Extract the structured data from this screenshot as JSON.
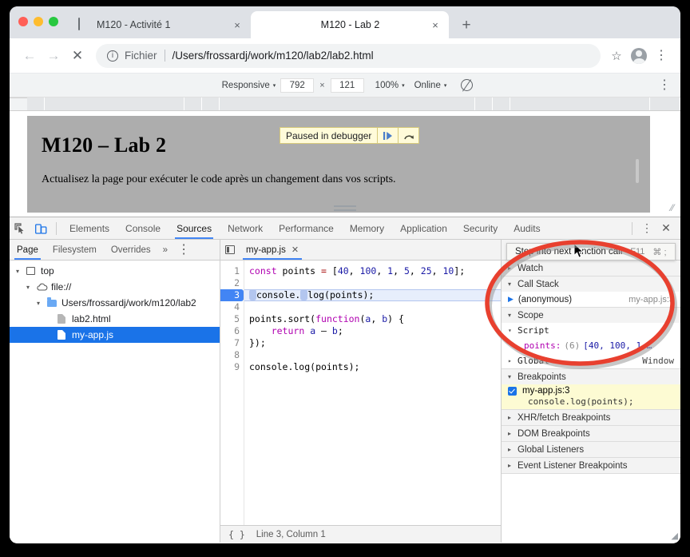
{
  "browser": {
    "tabs": [
      {
        "title": "M120 - Activité 1",
        "active": false,
        "favicon": "document-icon",
        "close_label": "×"
      },
      {
        "title": "M120 - Lab 2",
        "active": true,
        "favicon": "loading-dot-icon",
        "close_label": "×"
      }
    ],
    "new_tab_label": "+",
    "nav": {
      "back": "←",
      "forward": "→",
      "stop": "✕"
    },
    "omnibox": {
      "scheme_label": "Fichier",
      "url": "/Users/frossardj/work/m120/lab2/lab2.html",
      "info_glyph": "i",
      "bookmark_glyph": "☆",
      "menu_glyph": "⋮"
    }
  },
  "device_toolbar": {
    "device": "Responsive",
    "width": "792",
    "height": "121",
    "zoom": "100%",
    "network": "Online",
    "caret": "▾",
    "x_label": "×",
    "menu_glyph": "⋮"
  },
  "page": {
    "heading": "M120 – Lab 2",
    "paragraph": "Actualisez la page pour exécuter le code après un changement dans vos scripts.",
    "paused_banner": {
      "label": "Paused in debugger",
      "resume_glyph": "❙▶",
      "step_glyph": "⤴"
    }
  },
  "devtools": {
    "tabs": [
      "Elements",
      "Console",
      "Sources",
      "Network",
      "Performance",
      "Memory",
      "Application",
      "Security",
      "Audits"
    ],
    "selected_tab": "Sources",
    "inspect_icon": "inspect-element-icon",
    "device_icon": "toggle-device-toolbar-icon",
    "more_glyph": "⋮",
    "close_glyph": "✕",
    "navigator": {
      "subtabs": [
        "Page",
        "Filesystem",
        "Overrides"
      ],
      "selected_subtab": "Page",
      "more_glyph": "»",
      "menu_glyph": "⋮",
      "tree": [
        {
          "label": "top",
          "icon": "frame-icon",
          "indent": 0,
          "twisty": "▾",
          "selected": false
        },
        {
          "label": "file://",
          "icon": "cloud-icon",
          "indent": 1,
          "twisty": "▾",
          "selected": false
        },
        {
          "label": "Users/frossardj/work/m120/lab2",
          "icon": "folder-icon",
          "indent": 2,
          "twisty": "▾",
          "selected": false
        },
        {
          "label": "lab2.html",
          "icon": "file-icon",
          "indent": 3,
          "twisty": "",
          "selected": false
        },
        {
          "label": "my-app.js",
          "icon": "js-file-icon",
          "indent": 3,
          "twisty": "",
          "selected": true
        }
      ]
    },
    "editor": {
      "tab_name": "my-app.js",
      "tab_close": "✕",
      "lines": [
        {
          "n": "1",
          "text": "const points = [40, 100, 1, 5, 25, 10];",
          "breakpoint": false
        },
        {
          "n": "2",
          "text": "",
          "breakpoint": false
        },
        {
          "n": "3",
          "text": "console. log(points);",
          "breakpoint": true
        },
        {
          "n": "4",
          "text": "",
          "breakpoint": false
        },
        {
          "n": "5",
          "text": "points.sort(function(a, b) {",
          "breakpoint": false
        },
        {
          "n": "6",
          "text": "    return a - b;",
          "breakpoint": false
        },
        {
          "n": "7",
          "text": "});",
          "breakpoint": false
        },
        {
          "n": "8",
          "text": "",
          "breakpoint": false
        },
        {
          "n": "9",
          "text": "console.log(points);",
          "breakpoint": false
        }
      ],
      "status": {
        "format_glyph": "{ }",
        "position": "Line 3, Column 1"
      }
    },
    "debugger": {
      "toolbar_icons": [
        "resume-script-execution-icon",
        "step-over-next-function-call-icon",
        "step-into-next-function-call-icon",
        "step-out-of-current-function-icon",
        "step-icon",
        "deactivate-breakpoints-icon",
        "pause-on-exceptions-icon"
      ],
      "tooltip": {
        "text": "Step into next function call",
        "key": "F11",
        "key2": "⌘ ;"
      },
      "sections": [
        {
          "name": "Watch",
          "arrow": "▸",
          "expanded": false
        },
        {
          "name": "Call Stack",
          "arrow": "▾",
          "expanded": true
        },
        {
          "name": "Scope",
          "arrow": "▾",
          "expanded": true
        },
        {
          "name": "Breakpoints",
          "arrow": "▾",
          "expanded": true
        },
        {
          "name": "XHR/fetch Breakpoints",
          "arrow": "▸",
          "expanded": false
        },
        {
          "name": "DOM Breakpoints",
          "arrow": "▸",
          "expanded": false
        },
        {
          "name": "Global Listeners",
          "arrow": "▸",
          "expanded": false
        },
        {
          "name": "Event Listener Breakpoints",
          "arrow": "▸",
          "expanded": false
        }
      ],
      "call_stack": [
        {
          "frame": "(anonymous)",
          "location": "my-app.js:3",
          "marker": "▶"
        }
      ],
      "scope": {
        "script_label": "Script",
        "script_arrow": "▾",
        "var_name": "points:",
        "var_count": "(6)",
        "var_value": "[40, 100, 1,…",
        "var_arrow": "▸",
        "global_label": "Global",
        "global_arrow": "▸",
        "global_value": "Window"
      },
      "breakpoint": {
        "location": "my-app.js:3",
        "code": "console.log(points);",
        "checked": true
      }
    }
  },
  "colors": {
    "accent": "#4285f4",
    "selection": "#1a73e8",
    "annotation": "#e8402f",
    "page_bg": "#adadad",
    "banner_bg": "#fffbd9",
    "breakpoint_bg": "#fdfbd3"
  }
}
